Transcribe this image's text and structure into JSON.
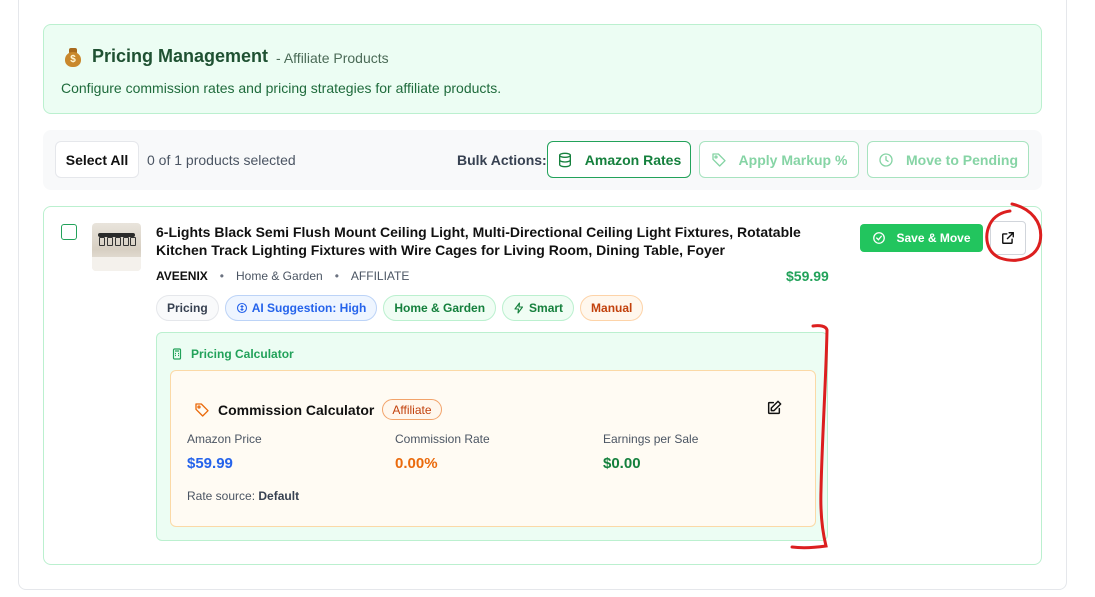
{
  "header": {
    "title": "Pricing Management",
    "subtitle": "- Affiliate Products",
    "description": "Configure commission rates and pricing strategies for affiliate products."
  },
  "toolbar": {
    "select_all": "Select All",
    "selection_count": "0 of 1 products selected",
    "bulk_label": "Bulk Actions:",
    "amazon_rates": "Amazon Rates",
    "apply_markup": "Apply Markup %",
    "move_pending": "Move to Pending"
  },
  "product": {
    "title": "6-Lights Black Semi Flush Mount Ceiling Light, Multi-Directional Ceiling Light Fixtures, Rotatable Kitchen Track Lighting Fixtures with Wire Cages for Living Room, Dining Table, Foyer",
    "brand": "AVEENIX",
    "category": "Home & Garden",
    "type": "AFFILIATE",
    "price": "$59.99",
    "tags": {
      "pricing": "Pricing",
      "ai": "AI Suggestion: High",
      "category": "Home & Garden",
      "smart": "Smart",
      "manual": "Manual"
    },
    "save_move": "Save & Move"
  },
  "calculator": {
    "panel_title": "Pricing Calculator",
    "title": "Commission Calculator",
    "badge": "Affiliate",
    "amazon_price_label": "Amazon Price",
    "amazon_price": "$59.99",
    "commission_rate_label": "Commission Rate",
    "commission_rate": "0.00%",
    "earnings_label": "Earnings per Sale",
    "earnings": "$0.00",
    "rate_source_label": "Rate source:",
    "rate_source": "Default"
  },
  "colors": {
    "accent_green": "#22c55e",
    "blue": "#2563eb",
    "orange": "#ea6a0c",
    "annotation_red": "#dc1f1f"
  }
}
